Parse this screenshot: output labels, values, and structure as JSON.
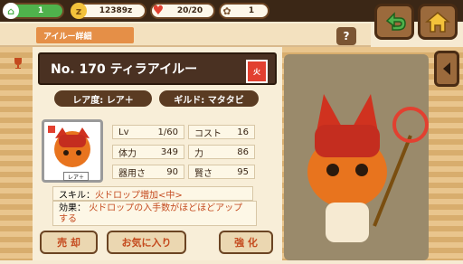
{
  "topbar": {
    "level_value": "1",
    "coins_value": "12389z",
    "hp_value": "20/20",
    "paw_value": "1"
  },
  "header": {
    "tag_label": "アイルー詳細",
    "help_label": "?"
  },
  "card": {
    "name": "No. 170 ティラアイルー",
    "rarity_label": "レア度: レア＋",
    "guild_label": "ギルド: マタタビ",
    "rare_badge": "レア＋",
    "stats": [
      {
        "label": "Lv",
        "value": "1/60"
      },
      {
        "label": "コスト",
        "value": "16"
      },
      {
        "label": "体力",
        "value": "349"
      },
      {
        "label": "力",
        "value": "86"
      },
      {
        "label": "器用さ",
        "value": "90"
      },
      {
        "label": "賢さ",
        "value": "95"
      }
    ],
    "skill_prefix": "スキル：",
    "skill_name": "火ドロップ増加<中>",
    "effect_label": "効果：",
    "effect_text": "火ドロップの入手数がほどほどアップする"
  },
  "actions": {
    "sell_label": "売 却",
    "favorite_label": "お気に入り",
    "enhance_label": "強 化"
  },
  "colors": {
    "accent_orange": "#e58f47",
    "dark_brown": "#4a3122",
    "green": "#4fb24c",
    "red": "#e24030"
  }
}
